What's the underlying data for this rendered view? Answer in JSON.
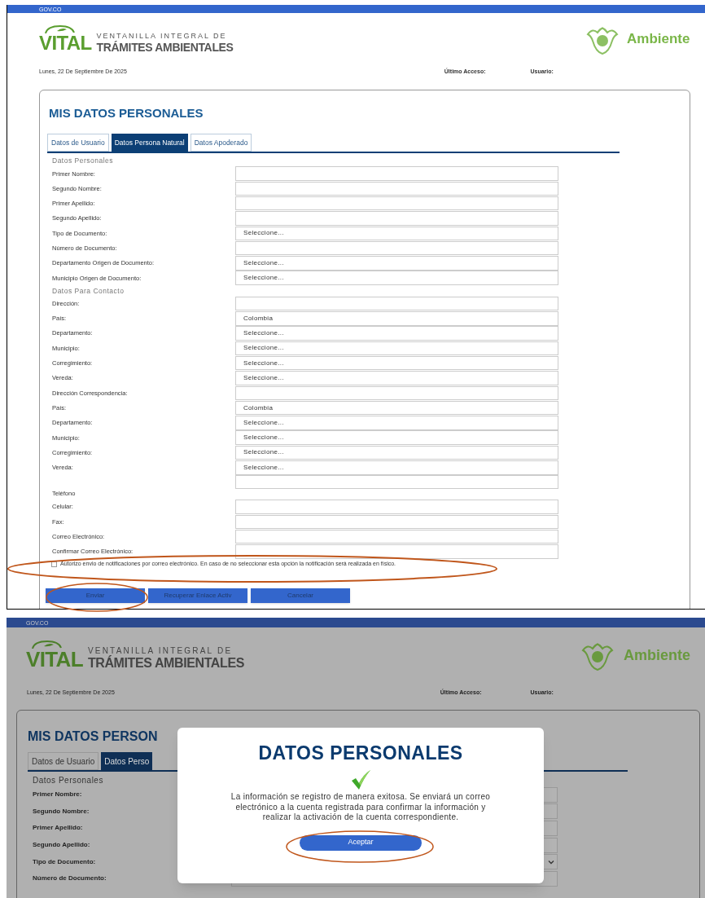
{
  "screens": [
    {
      "gov_bar": "GOV.CO",
      "header": {
        "logo_text": "VITAL",
        "tagline_1": "VENTANILLA INTEGRAL DE",
        "tagline_2": "TRÁMITES AMBIENTALES",
        "ministry": "Ambiente"
      },
      "info_bar": {
        "date": "Lunes, 22 De Septiembre De 2025",
        "last_access": "Último Acceso:",
        "user": "Usuario:"
      },
      "card": {
        "title": "MIS DATOS PERSONALES",
        "tabs": [
          {
            "label": "Datos de Usuario",
            "selected": false
          },
          {
            "label": "Datos Persona Natural",
            "selected": true
          },
          {
            "label": "Datos Apoderado",
            "selected": false
          }
        ],
        "rows": [
          {
            "kind": "section",
            "label": "Datos Personales"
          },
          {
            "kind": "input",
            "label": "Primer Nombre:"
          },
          {
            "kind": "input",
            "label": "Segundo Nombre:"
          },
          {
            "kind": "input",
            "label": "Primer Apellido:"
          },
          {
            "kind": "input",
            "label": "Segundo Apellido:"
          },
          {
            "kind": "select",
            "label": "Tipo de Documento:",
            "value": "Seleccione..."
          },
          {
            "kind": "input",
            "label": "Número de Documento:"
          },
          {
            "kind": "select",
            "label": "Departamento Origen de Documento:",
            "value": "Seleccione..."
          },
          {
            "kind": "select",
            "label": "Municipio Origen de Documento:",
            "value": "Seleccione..."
          },
          {
            "kind": "section",
            "label": "Datos Para Contacto"
          },
          {
            "kind": "input",
            "label": "Dirección:"
          },
          {
            "kind": "select",
            "label": "País:",
            "value": "Colombia"
          },
          {
            "kind": "select",
            "label": "Departamento:",
            "value": "Seleccione..."
          },
          {
            "kind": "select",
            "label": "Municipio:",
            "value": "Seleccione..."
          },
          {
            "kind": "select",
            "label": "Corregimiento:",
            "value": "Seleccione..."
          },
          {
            "kind": "select",
            "label": "Vereda:",
            "value": "Seleccione..."
          },
          {
            "kind": "input",
            "label": "Dirección Correspondencia:"
          },
          {
            "kind": "select",
            "label": "País:",
            "value": "Colombia"
          },
          {
            "kind": "select",
            "label": "Departamento:",
            "value": "Seleccione..."
          },
          {
            "kind": "select",
            "label": "Municipio:",
            "value": "Seleccione..."
          },
          {
            "kind": "select",
            "label": "Corregimiento:",
            "value": "Seleccione..."
          },
          {
            "kind": "select",
            "label": "Vereda:",
            "value": "Seleccione..."
          },
          {
            "kind": "spaced",
            "label": "Teléfono"
          },
          {
            "kind": "input",
            "label": "Celular:"
          },
          {
            "kind": "input",
            "label": "Fax:"
          },
          {
            "kind": "input",
            "label": "Correo Electrónico:"
          },
          {
            "kind": "input",
            "label": "Confirmar Correo Electrónico:"
          }
        ],
        "consent": {
          "checked": false,
          "text": "Autorizo envio de notificaciones por correo electrónico. En caso de no seleccionar esta opción la notificación será realizada en físico."
        },
        "buttons": [
          "Enviar",
          "Recuperar Enlace Activ",
          "Cancelar"
        ]
      }
    },
    {
      "gov_bar": "GOV.CO",
      "header": {
        "logo_text": "VITAL",
        "tagline_1": "VENTANILLA INTEGRAL DE",
        "tagline_2": "TRÁMITES AMBIENTALES",
        "ministry": "Ambiente"
      },
      "info_bar": {
        "date": "Lunes, 22 De Septiembre De 2025",
        "last_access": "Último Acceso:",
        "user": "Usuario:"
      },
      "card": {
        "title": "MIS DATOS PERSON",
        "tabs": [
          {
            "label": "Datos de Usuario",
            "selected": false
          },
          {
            "label": "Datos Perso",
            "selected": true
          }
        ],
        "rows": [
          {
            "kind": "section",
            "label": "Datos Personales"
          },
          {
            "kind": "input",
            "label": "Primer Nombre:"
          },
          {
            "kind": "input",
            "label": "Segundo Nombre:"
          },
          {
            "kind": "input",
            "label": "Primer Apellido:"
          },
          {
            "kind": "input",
            "label": "Segundo Apellido:"
          },
          {
            "kind": "dropdown",
            "label": "Tipo de Documento:"
          },
          {
            "kind": "input",
            "label": "Número de Documento:"
          }
        ]
      },
      "modal": {
        "title": "DATOS PERSONALES",
        "message": "La información se registro de manera exitosa. Se enviará un correo electrónico a la cuenta registrada para confirmar la información y realizar la activación de la cuenta correspondiente.",
        "button": "Aceptar"
      }
    }
  ]
}
